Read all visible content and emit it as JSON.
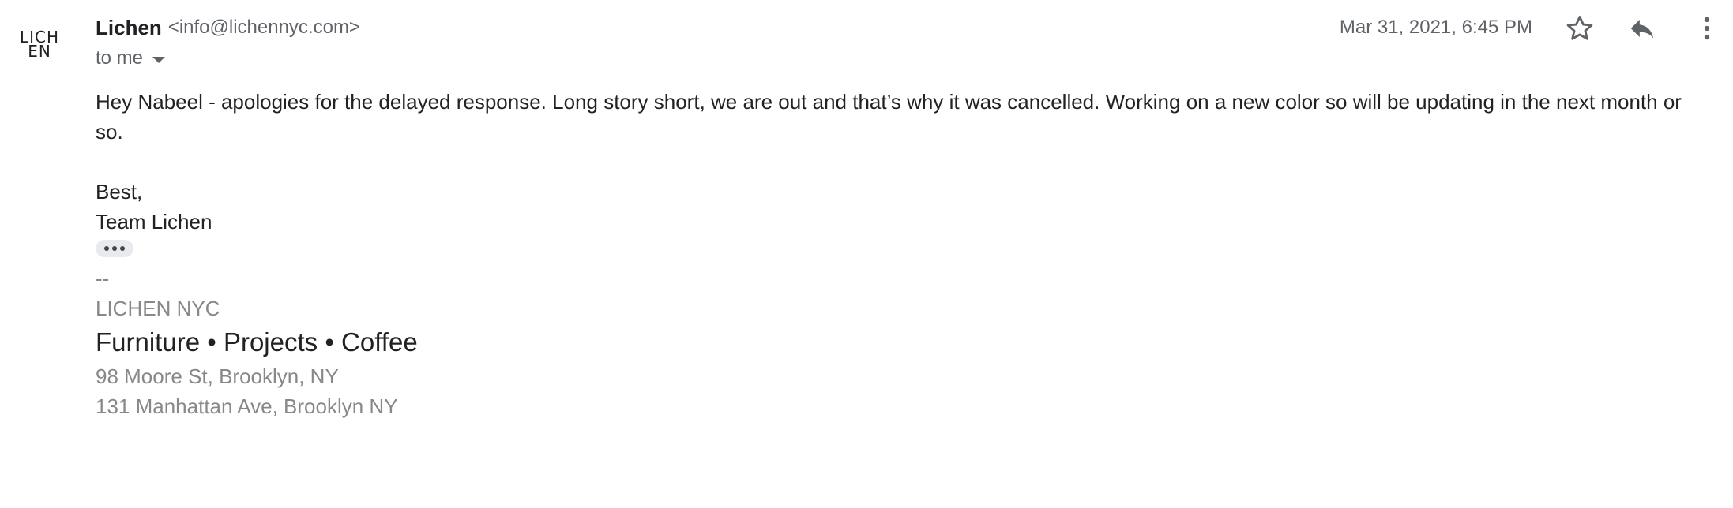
{
  "avatar": {
    "line1": "LICH",
    "line2": "EN"
  },
  "sender": {
    "name": "Lichen",
    "email": "<info@lichennyc.com>"
  },
  "recipient": {
    "label": "to me"
  },
  "date": "Mar 31, 2021, 6:45 PM",
  "actions": {
    "star_icon": "star-icon",
    "reply_icon": "reply-icon",
    "more_icon": "more-vert-icon"
  },
  "body": {
    "paragraph": "Hey Nabeel - apologies for the delayed response. Long story short, we are out and that’s why it was cancelled. Working on a new color so will be updating in the next month or so.",
    "closing": "Best,",
    "signoff": "Team Lichen"
  },
  "signature": {
    "dash": "--",
    "company": "LICHEN NYC",
    "tagline": "Furniture • Projects • Coffee",
    "address1": "98 Moore St, Brooklyn, NY",
    "address2": "131 Manhattan Ave, Brooklyn NY"
  },
  "colors": {
    "text": "#202124",
    "muted": "#5f6368",
    "signature_gray": "#888888",
    "icon": "#5f6368"
  }
}
